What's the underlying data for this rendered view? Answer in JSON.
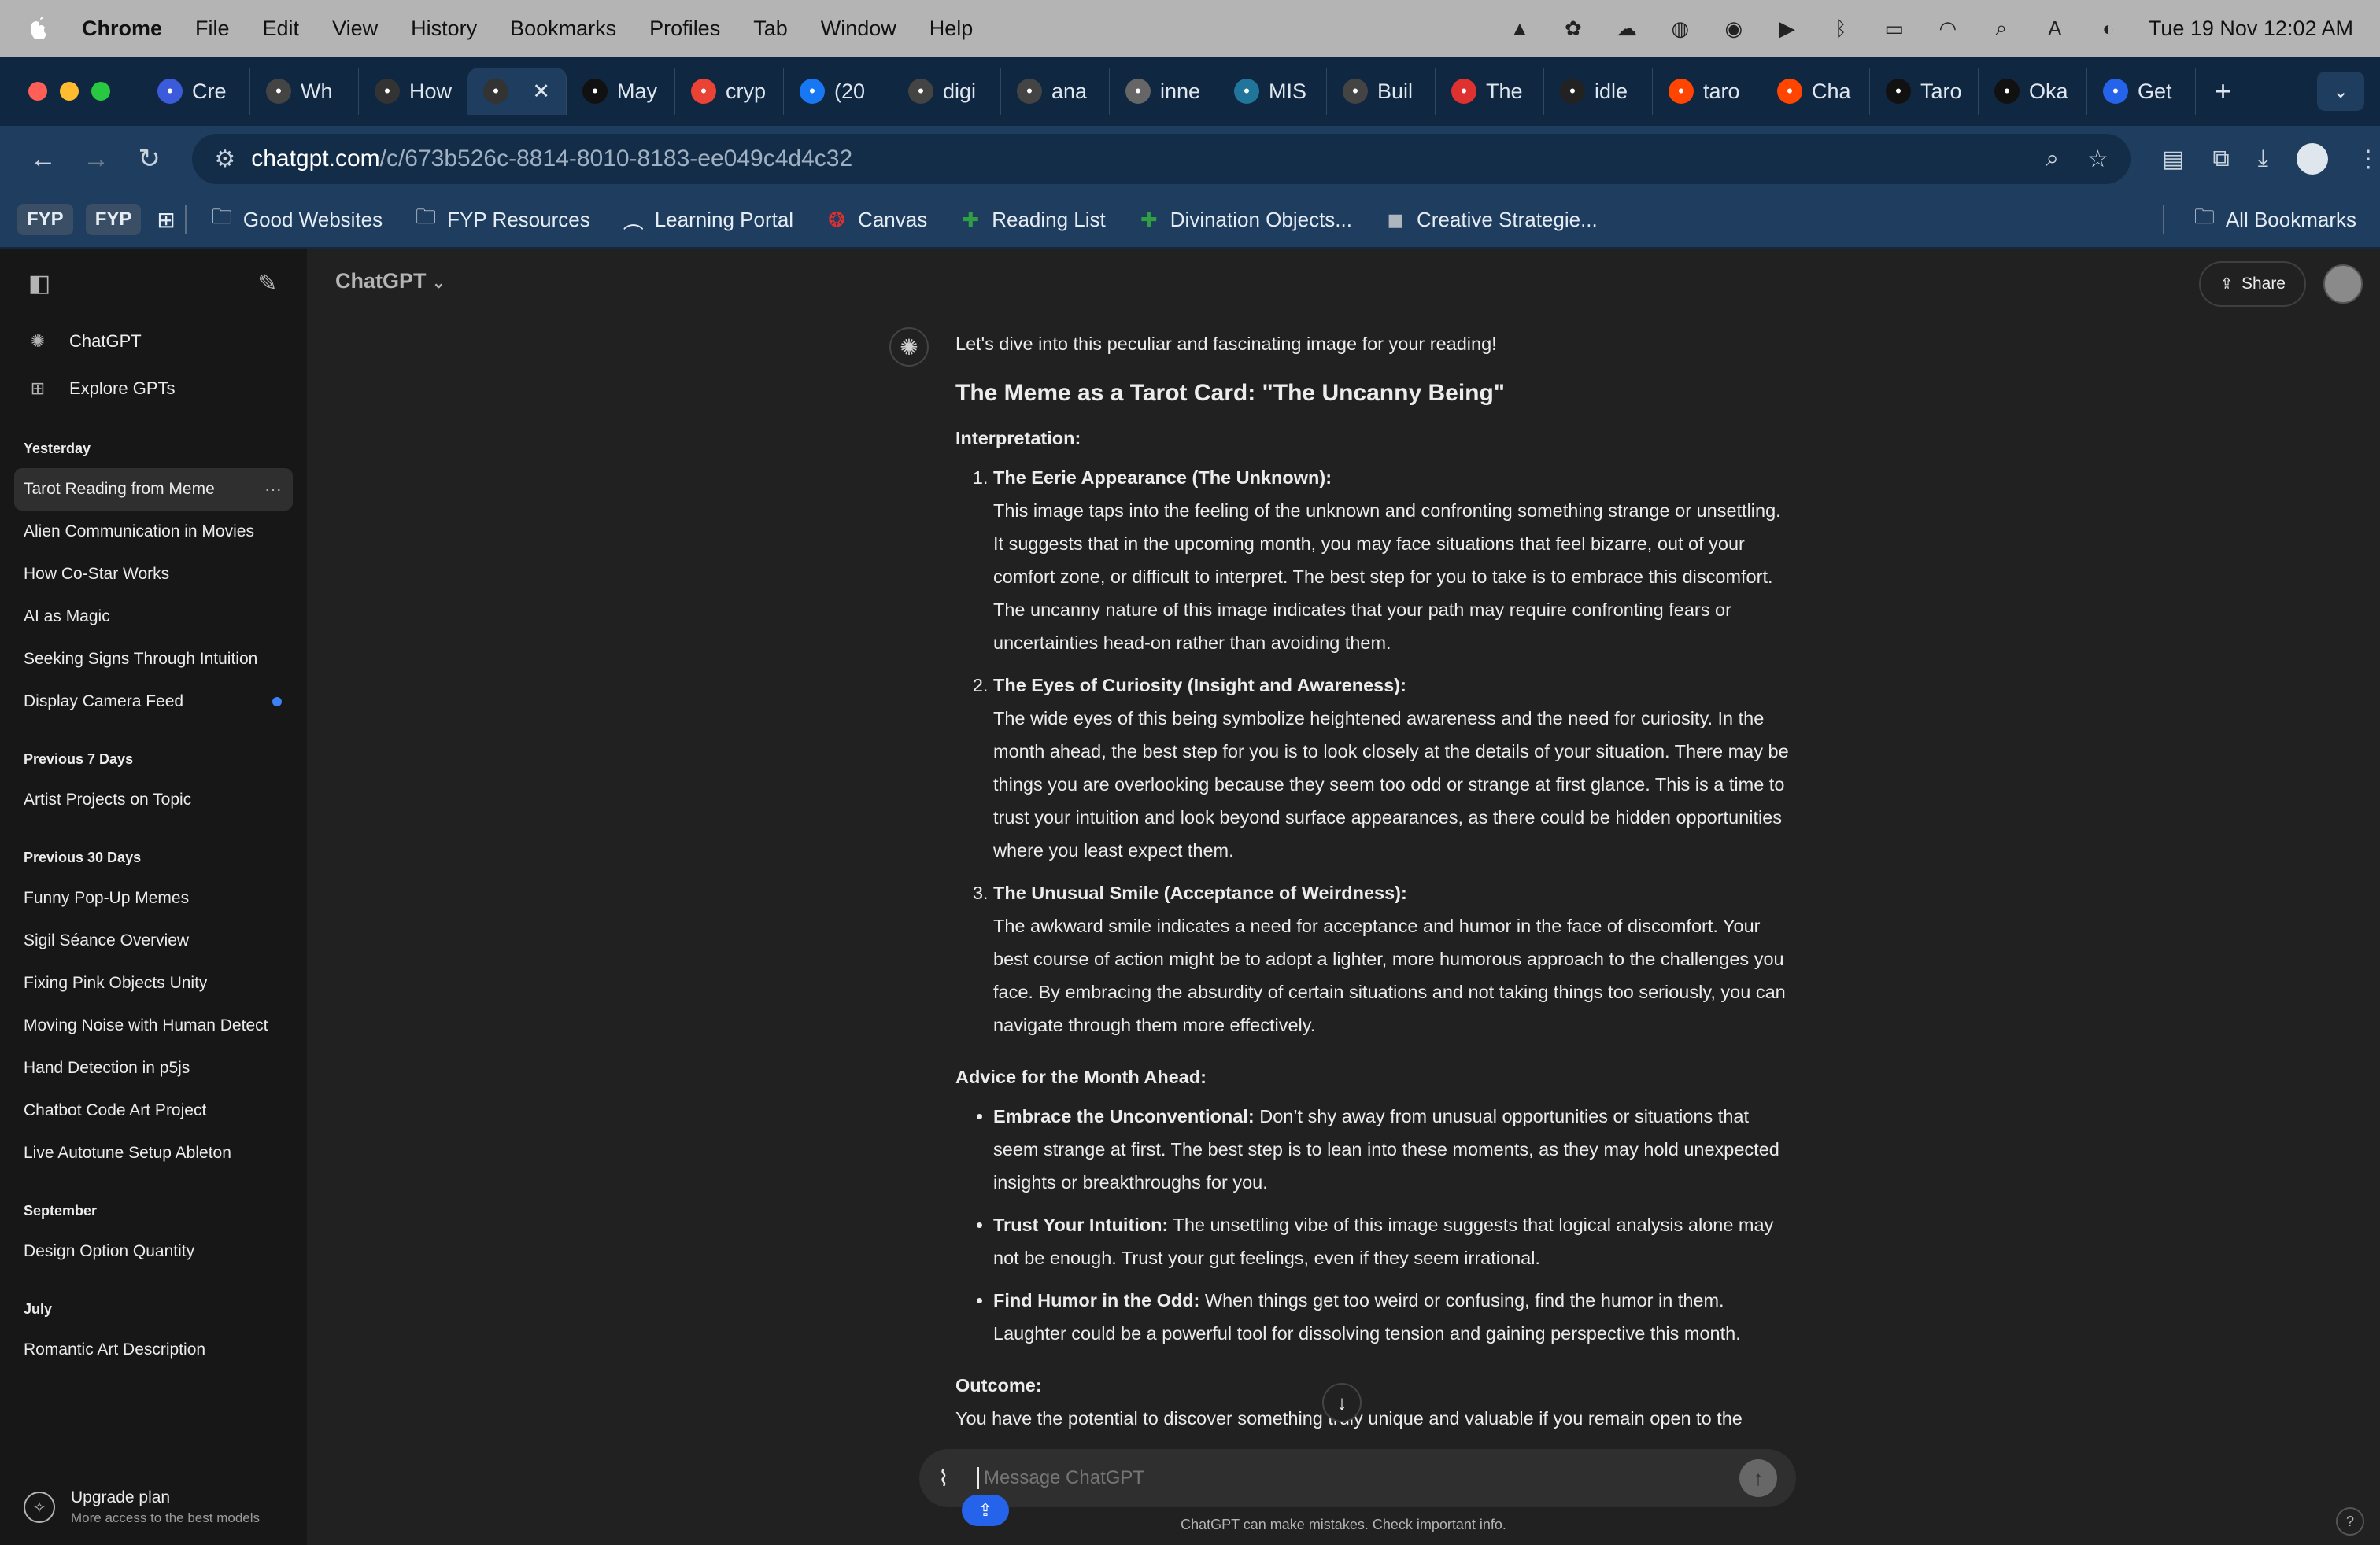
{
  "menubar": {
    "app": "Chrome",
    "items": [
      "File",
      "Edit",
      "View",
      "History",
      "Bookmarks",
      "Profiles",
      "Tab",
      "Window",
      "Help"
    ],
    "datetime": "Tue 19 Nov  12:02 AM"
  },
  "tabs": [
    {
      "label": "Cre",
      "color": "#3b5bdb"
    },
    {
      "label": "Wh",
      "color": "#444"
    },
    {
      "label": "How",
      "color": "#333"
    },
    {
      "label": "",
      "color": "#333",
      "active": true
    },
    {
      "label": "May",
      "color": "#111"
    },
    {
      "label": "cryp",
      "color": "#ea4335"
    },
    {
      "label": "(20",
      "color": "#1877f2"
    },
    {
      "label": "digi",
      "color": "#444"
    },
    {
      "label": "ana",
      "color": "#444"
    },
    {
      "label": "inne",
      "color": "#666"
    },
    {
      "label": "MIS",
      "color": "#21759b"
    },
    {
      "label": "Buil",
      "color": "#444"
    },
    {
      "label": "The",
      "color": "#e03131"
    },
    {
      "label": "idle",
      "color": "#222"
    },
    {
      "label": "taro",
      "color": "#ff4500"
    },
    {
      "label": "Cha",
      "color": "#ff4500"
    },
    {
      "label": "Taro",
      "color": "#111"
    },
    {
      "label": "Oka",
      "color": "#111"
    },
    {
      "label": "Get",
      "color": "#2563eb"
    }
  ],
  "address": {
    "host": "chatgpt.com",
    "path": "/c/673b526c-8814-8010-8183-ee049c4d4c32"
  },
  "bookmarks": {
    "chips": [
      "FYP",
      "FYP"
    ],
    "items": [
      "Good Websites",
      "FYP Resources",
      "Learning Portal",
      "Canvas",
      "Reading List",
      "Divination Objects...",
      "Creative Strategie..."
    ],
    "all": "All Bookmarks"
  },
  "sidebar": {
    "nav": [
      "ChatGPT",
      "Explore GPTs"
    ],
    "sections": [
      {
        "heading": "Yesterday",
        "items": [
          "Tarot Reading from Meme",
          "Alien Communication in Movies",
          "How Co-Star Works",
          "AI as Magic",
          "Seeking Signs Through Intuition",
          "Display Camera Feed"
        ]
      },
      {
        "heading": "Previous 7 Days",
        "items": [
          "Artist Projects on Topic"
        ]
      },
      {
        "heading": "Previous 30 Days",
        "items": [
          "Funny Pop-Up Memes",
          "Sigil Séance Overview",
          "Fixing Pink Objects Unity",
          "Moving Noise with Human Detect",
          "Hand Detection in p5js",
          "Chatbot Code Art Project",
          "Live Autotune Setup Ableton"
        ]
      },
      {
        "heading": "September",
        "items": [
          "Design Option Quantity"
        ]
      },
      {
        "heading": "July",
        "items": [
          "Romantic Art Description"
        ]
      }
    ],
    "upgrade_title": "Upgrade plan",
    "upgrade_sub": "More access to the best models"
  },
  "header": {
    "model": "ChatGPT",
    "share": "Share"
  },
  "message": {
    "intro": "Let's dive into this peculiar and fascinating image for your reading!",
    "heading": "The Meme as a Tarot Card: \"The Uncanny Being\"",
    "interp_label": "Interpretation:",
    "points": [
      {
        "title": "The Eerie Appearance (The Unknown):",
        "body": "This image taps into the feeling of the unknown and confronting something strange or unsettling. It suggests that in the upcoming month, you may face situations that feel bizarre, out of your comfort zone, or difficult to interpret. The best step for you to take is to embrace this discomfort. The uncanny nature of this image indicates that your path may require confronting fears or uncertainties head-on rather than avoiding them."
      },
      {
        "title": "The Eyes of Curiosity (Insight and Awareness):",
        "body": "The wide eyes of this being symbolize heightened awareness and the need for curiosity. In the month ahead, the best step for you is to look closely at the details of your situation. There may be things you are overlooking because they seem too odd or strange at first glance. This is a time to trust your intuition and look beyond surface appearances, as there could be hidden opportunities where you least expect them."
      },
      {
        "title": "The Unusual Smile (Acceptance of Weirdness):",
        "body": "The awkward smile indicates a need for acceptance and humor in the face of discomfort. Your best course of action might be to adopt a lighter, more humorous approach to the challenges you face. By embracing the absurdity of certain situations and not taking things too seriously, you can navigate through them more effectively."
      }
    ],
    "advice_label": "Advice for the Month Ahead:",
    "advice": [
      {
        "title": "Embrace the Unconventional:",
        "body": " Don’t shy away from unusual opportunities or situations that seem strange at first. The best step is to lean into these moments, as they may hold unexpected insights or breakthroughs for you."
      },
      {
        "title": "Trust Your Intuition:",
        "body": " The unsettling vibe of this image suggests that logical analysis alone may not be enough. Trust your gut feelings, even if they seem irrational."
      },
      {
        "title": "Find Humor in the Odd:",
        "body": " When things get too weird or confusing, find the humor in them. Laughter could be a powerful tool for dissolving tension and gaining perspective this month."
      }
    ],
    "outcome_label": "Outcome:",
    "outcome": "You have the potential to discover something truly unique and valuable if you remain open to the"
  },
  "composer": {
    "placeholder": "Message ChatGPT",
    "disclaimer": "ChatGPT can make mistakes. Check important info."
  }
}
